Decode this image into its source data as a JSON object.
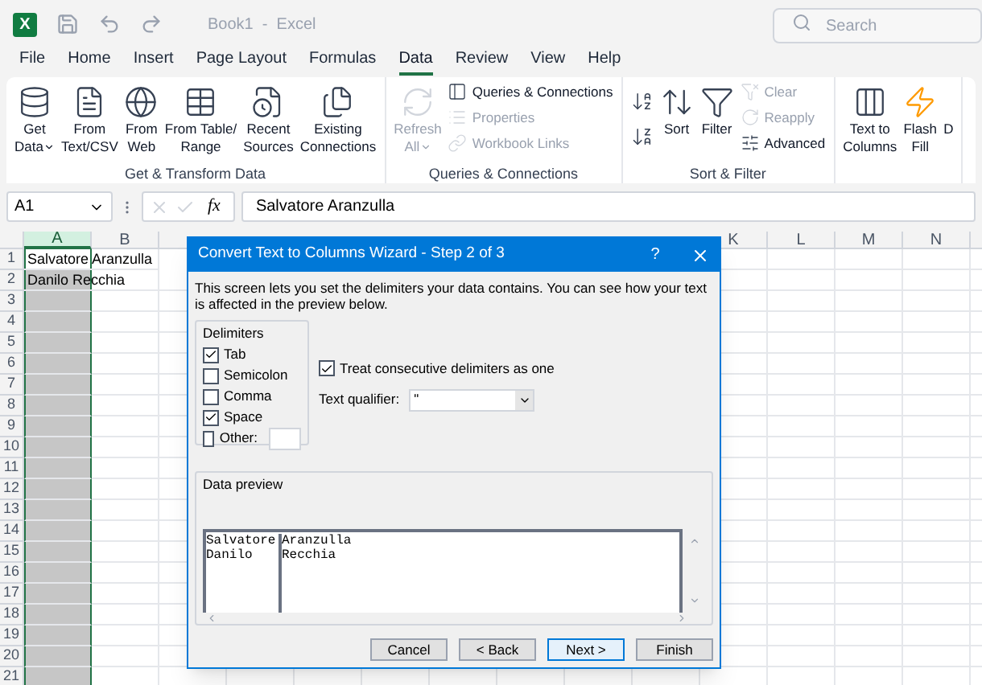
{
  "title_bar": {
    "app_badge": "X",
    "title": "Book1  -  Excel",
    "search": {
      "placeholder": "Search"
    }
  },
  "tabs": [
    {
      "label": "File",
      "selected": false
    },
    {
      "label": "Home",
      "selected": false
    },
    {
      "label": "Insert",
      "selected": false
    },
    {
      "label": "Page Layout",
      "selected": false
    },
    {
      "label": "Formulas",
      "selected": false
    },
    {
      "label": "Data",
      "selected": true
    },
    {
      "label": "Review",
      "selected": false
    },
    {
      "label": "View",
      "selected": false
    },
    {
      "label": "Help",
      "selected": false
    }
  ],
  "ribbon": {
    "groups": [
      {
        "label": "Get & Transform Data",
        "items": [
          {
            "kind": "large",
            "lines": [
              "Get",
              "Data"
            ],
            "menu": true,
            "disabled": false
          },
          {
            "kind": "large",
            "lines": [
              "From",
              "Text/CSV"
            ],
            "menu": false,
            "disabled": false
          },
          {
            "kind": "large",
            "lines": [
              "From",
              "Web"
            ],
            "menu": false,
            "disabled": false
          },
          {
            "kind": "large",
            "lines": [
              "From Table/",
              "Range"
            ],
            "menu": false,
            "disabled": false
          },
          {
            "kind": "large",
            "lines": [
              "Recent",
              "Sources"
            ],
            "menu": false,
            "disabled": false
          },
          {
            "kind": "large",
            "lines": [
              "Existing",
              "Connections"
            ],
            "menu": false,
            "disabled": false
          }
        ]
      },
      {
        "label": "Queries & Connections",
        "items": [
          {
            "kind": "large",
            "lines": [
              "Refresh",
              "All"
            ],
            "menu": true,
            "disabled": true
          },
          {
            "kind": "stack",
            "entries": [
              {
                "label": "Queries & Connections",
                "disabled": false
              },
              {
                "label": "Properties",
                "disabled": true
              },
              {
                "label": "Workbook Links",
                "disabled": true
              }
            ]
          }
        ]
      },
      {
        "label": "Sort & Filter",
        "items": [
          {
            "kind": "sortpair"
          },
          {
            "kind": "large",
            "lines": [
              "Sort"
            ],
            "menu": false,
            "disabled": false
          },
          {
            "kind": "large",
            "lines": [
              "Filter"
            ],
            "menu": false,
            "disabled": false
          },
          {
            "kind": "stack",
            "entries": [
              {
                "label": "Clear",
                "disabled": true
              },
              {
                "label": "Reapply",
                "disabled": true
              },
              {
                "label": "Advanced",
                "disabled": false
              }
            ]
          }
        ]
      },
      {
        "items": [
          {
            "kind": "large",
            "lines": [
              "Text to",
              "Columns"
            ],
            "menu": false,
            "disabled": false
          },
          {
            "kind": "large",
            "lines": [
              "Flash",
              "Fill"
            ],
            "menu": false,
            "disabled": false
          },
          {
            "kind": "large",
            "lines": [
              "D"
            ],
            "menu": false,
            "disabled": false
          }
        ]
      }
    ]
  },
  "formula_bar": {
    "name_box": "A1",
    "fx": "fx",
    "value": "Salvatore Aranzulla"
  },
  "sheet": {
    "columns_left": [
      {
        "label": "A",
        "selected": true
      },
      {
        "label": "B",
        "selected": false
      }
    ],
    "columns_right": [
      {
        "label": "K",
        "selected": false
      },
      {
        "label": "L",
        "selected": false
      },
      {
        "label": "M",
        "selected": false
      },
      {
        "label": "N",
        "selected": false
      }
    ],
    "rows": [
      {
        "number": "1",
        "cell": "Salvatore Aranzulla"
      },
      {
        "number": "2",
        "cell": "Danilo Recchia"
      },
      {
        "number": "3"
      },
      {
        "number": "4"
      },
      {
        "number": "5"
      },
      {
        "number": "6"
      },
      {
        "number": "7"
      },
      {
        "number": "8"
      },
      {
        "number": "9"
      },
      {
        "number": "10"
      },
      {
        "number": "11"
      },
      {
        "number": "12"
      },
      {
        "number": "13"
      },
      {
        "number": "14"
      },
      {
        "number": "15"
      },
      {
        "number": "16"
      },
      {
        "number": "17"
      },
      {
        "number": "18"
      },
      {
        "number": "19"
      },
      {
        "number": "20"
      },
      {
        "number": "21"
      }
    ]
  },
  "dialog": {
    "title": "Convert Text to Columns Wizard - Step 2 of 3",
    "help": "?",
    "description": "This screen lets you set the delimiters your data contains.  You can see how your text is affected in the preview below.",
    "delimiters": {
      "label": "Delimiters",
      "options": [
        {
          "kind": "plain",
          "label": "Tab",
          "checked": true
        },
        {
          "kind": "plain",
          "label": "Semicolon",
          "checked": false
        },
        {
          "kind": "plain",
          "label": "Comma",
          "checked": false
        },
        {
          "kind": "plain",
          "label": "Space",
          "checked": true
        },
        {
          "kind": "field",
          "label": "Other:",
          "checked": false
        }
      ]
    },
    "consecutive": {
      "label": "Treat consecutive delimiters as one",
      "checked": true
    },
    "qualifier": {
      "label": "Text qualifier:",
      "value": "\""
    },
    "preview": {
      "label": "Data preview",
      "columns": [
        [
          "Salvatore",
          "Danilo"
        ],
        [
          "Aranzulla",
          "Recchia"
        ]
      ]
    },
    "buttons": [
      {
        "label": "Cancel",
        "default": false
      },
      {
        "label": "< Back",
        "default": false
      },
      {
        "label": "Next >",
        "default": true
      },
      {
        "label": "Finish",
        "default": false
      }
    ]
  }
}
